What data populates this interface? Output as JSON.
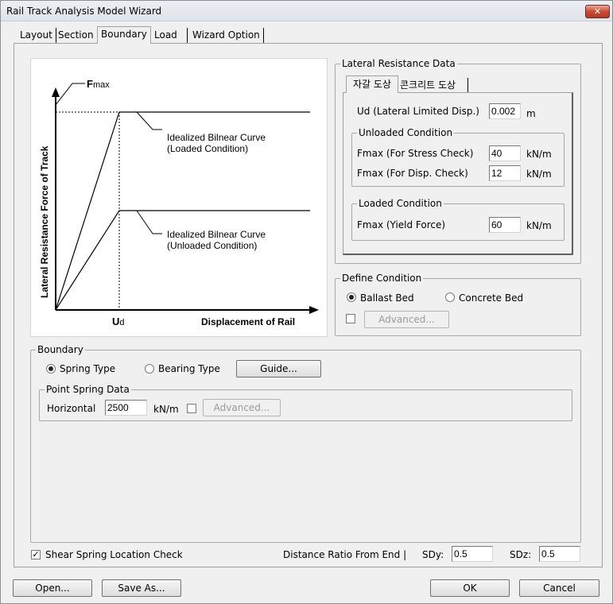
{
  "window": {
    "title": "Rail Track Analysis Model Wizard",
    "close_glyph": "✕"
  },
  "tabs": [
    {
      "label": "Layout"
    },
    {
      "label": "Section"
    },
    {
      "label": "Boundary",
      "active": true
    },
    {
      "label": "Load"
    },
    {
      "label": "Wizard Option"
    }
  ],
  "diagram": {
    "y_axis_label": "Lateral Resistance Force of Track",
    "x_axis_label": "Displacement of Rail",
    "fmax_label": "F",
    "fmax_sub": "max",
    "ud_label": "U",
    "ud_sub": "d",
    "curve_loaded_line1": "Idealized Bilnear Curve",
    "curve_loaded_line2": "(Loaded Condition)",
    "curve_unloaded_line1": "Idealized Bilnear Curve",
    "curve_unloaded_line2": "(Unloaded Condition)"
  },
  "lateral_resistance": {
    "legend": "Lateral Resistance Data",
    "inner_tabs": [
      "자갈 도상",
      "콘크리트 도상"
    ],
    "ud_label": "Ud (Lateral Limited Disp.)",
    "ud_value": "0.002",
    "ud_unit": "m",
    "unloaded": {
      "legend": "Unloaded Condition",
      "stress_label": "Fmax (For Stress Check)",
      "stress_value": "40",
      "disp_label": "Fmax (For Disp. Check)",
      "disp_value": "12",
      "unit": "kN/m"
    },
    "loaded": {
      "legend": "Loaded Condition",
      "yield_label": "Fmax (Yield Force)",
      "yield_value": "60",
      "unit": "kN/m"
    }
  },
  "define_condition": {
    "legend": "Define Condition",
    "ballast_label": "Ballast Bed",
    "concrete_label": "Concrete Bed",
    "selected": "Ballast Bed",
    "advanced_label": "Advanced..."
  },
  "boundary": {
    "legend": "Boundary",
    "spring_label": "Spring Type",
    "bearing_label": "Bearing Type",
    "selected": "Spring Type",
    "guide_label": "Guide...",
    "point_spring": {
      "legend": "Point Spring Data",
      "horizontal_label": "Horizontal",
      "horizontal_value": "2500",
      "unit": "kN/m",
      "advanced_label": "Advanced..."
    }
  },
  "bottom_options": {
    "shear_check_label": "Shear Spring Location Check",
    "shear_checked": true,
    "distance_ratio_label": "Distance Ratio From End |",
    "sdy_label": "SDy:",
    "sdy_value": "0.5",
    "sdz_label": "SDz:",
    "sdz_value": "0.5"
  },
  "footer": {
    "open_label": "Open...",
    "save_as_label": "Save As...",
    "ok_label": "OK",
    "cancel_label": "Cancel"
  }
}
